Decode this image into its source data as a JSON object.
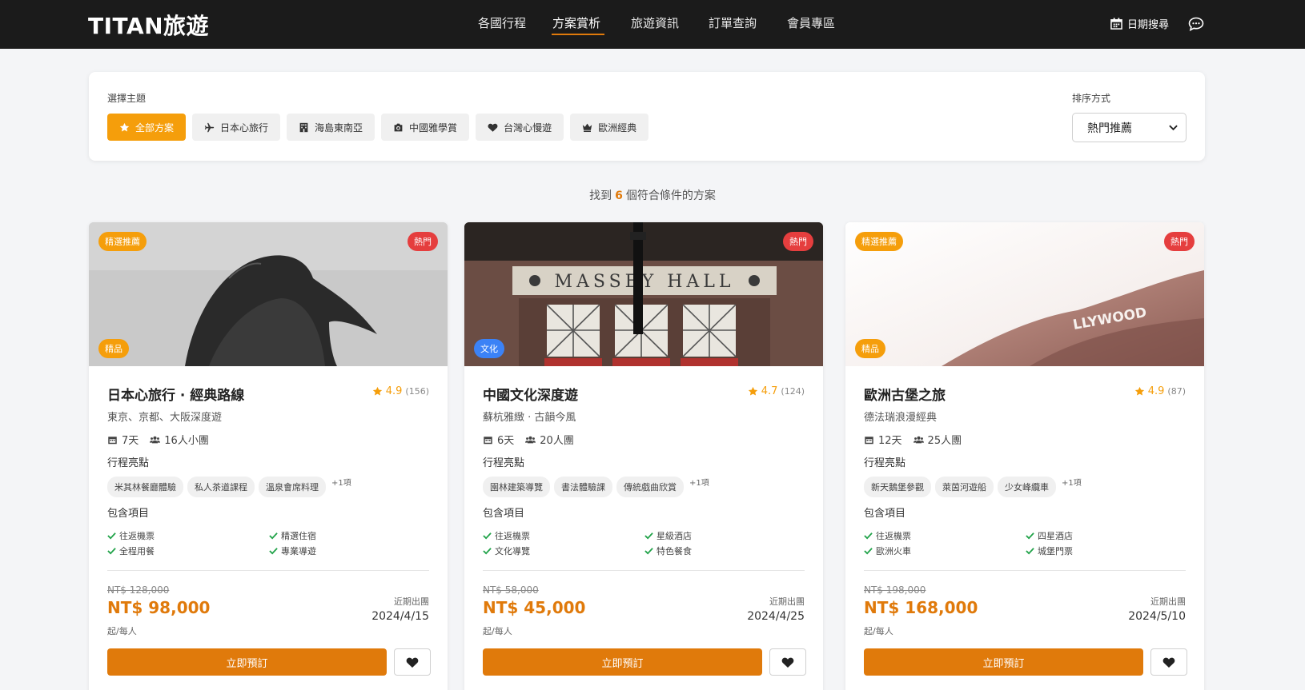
{
  "header": {
    "logo": "TITAN旅遊",
    "nav": [
      "各國行程",
      "方案賞析",
      "旅遊資訊",
      "訂單查詢",
      "會員專區"
    ],
    "active_index": 1,
    "date_search": "日期搜尋"
  },
  "filter": {
    "theme_label": "選擇主題",
    "chips": [
      {
        "label": "全部方案",
        "icon": "star-icon",
        "active": true
      },
      {
        "label": "日本心旅行",
        "icon": "plane-icon",
        "active": false
      },
      {
        "label": "海島東南亞",
        "icon": "building-icon",
        "active": false
      },
      {
        "label": "中國雅學賞",
        "icon": "camera-icon",
        "active": false
      },
      {
        "label": "台灣心慢遊",
        "icon": "heart-icon",
        "active": false
      },
      {
        "label": "歐洲經典",
        "icon": "crown-icon",
        "active": false
      }
    ],
    "sort_label": "排序方式",
    "sort_value": "熱門推薦"
  },
  "results": {
    "prefix": "找到",
    "count": "6",
    "suffix": "個符合條件的方案"
  },
  "labels": {
    "highlights": "行程亮點",
    "includes": "包含項目",
    "per_person": "起/每人",
    "departure": "近期出團",
    "book": "立即預訂"
  },
  "cards": [
    {
      "featured": "精選推薦",
      "hot": "熱門",
      "category": "精品",
      "category_color": "#f59e0b",
      "title": "日本心旅行 · 經典路線",
      "rating": "4.9",
      "reviews": "(156)",
      "subtitle": "東京、京都、大阪深度遊",
      "days": "7天",
      "group": "16人小團",
      "tags": [
        "米其林餐廳體驗",
        "私人茶道課程",
        "溫泉會席料理"
      ],
      "more": "+1項",
      "includes": [
        "往返機票",
        "精選住宿",
        "全程用餐",
        "專業導遊"
      ],
      "old_price": "NT$ 128,000",
      "price": "NT$ 98,000",
      "date": "2024/4/15"
    },
    {
      "featured": "",
      "hot": "熱門",
      "category": "文化",
      "category_color": "#3b82f6",
      "title": "中國文化深度遊",
      "rating": "4.7",
      "reviews": "(124)",
      "subtitle": "蘇杭雅緻 · 古韻今風",
      "days": "6天",
      "group": "20人團",
      "tags": [
        "園林建築導覽",
        "書法體驗課",
        "傳統戲曲欣賞"
      ],
      "more": "+1項",
      "includes": [
        "往返機票",
        "星級酒店",
        "文化導覽",
        "特色餐食"
      ],
      "old_price": "NT$ 58,000",
      "price": "NT$ 45,000",
      "date": "2024/4/25"
    },
    {
      "featured": "精選推薦",
      "hot": "熱門",
      "category": "精品",
      "category_color": "#f59e0b",
      "title": "歐洲古堡之旅",
      "rating": "4.9",
      "reviews": "(87)",
      "subtitle": "德法瑞浪漫經典",
      "days": "12天",
      "group": "25人團",
      "tags": [
        "新天鵝堡參觀",
        "萊茵河遊船",
        "少女峰纜車"
      ],
      "more": "+1項",
      "includes": [
        "往返機票",
        "四星酒店",
        "歐洲火車",
        "城堡門票"
      ],
      "old_price": "NT$ 198,000",
      "price": "NT$ 168,000",
      "date": "2024/5/10"
    }
  ],
  "colors": {
    "accent": "#e07a0b",
    "badge_featured": "#f59e0b",
    "badge_hot": "#e53e3e",
    "nav_bg": "#1b1b1b"
  }
}
